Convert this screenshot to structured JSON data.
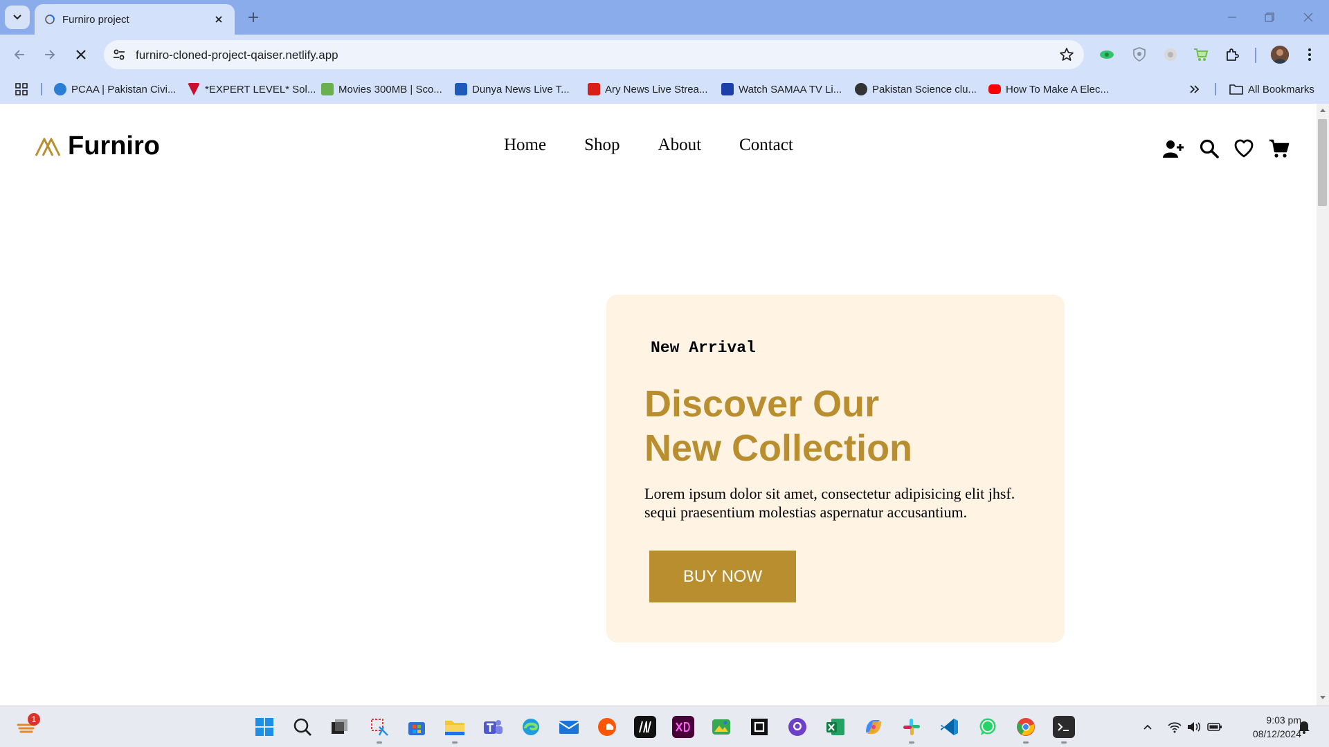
{
  "browser": {
    "tab_title": "Furniro project",
    "url": "furniro-cloned-project-qaiser.netlify.app",
    "bookmarks": [
      {
        "label": "PCAA | Pakistan Civi...",
        "color": "#2a7fd4"
      },
      {
        "label": "*EXPERT LEVEL* Sol...",
        "color": "#c8102e"
      },
      {
        "label": "Movies 300MB | Sco...",
        "color": "#6ab04c"
      },
      {
        "label": "Dunya News Live T...",
        "color": "#1e5bb8"
      },
      {
        "label": "Ary News Live Strea...",
        "color": "#d91e18"
      },
      {
        "label": "Watch SAMAA TV Li...",
        "color": "#1c3faa"
      },
      {
        "label": "Pakistan Science clu...",
        "color": "#333333"
      },
      {
        "label": "How To Make A Elec...",
        "color": "#ff0000"
      }
    ],
    "all_bookmarks": "All Bookmarks"
  },
  "site": {
    "logo": "Furniro",
    "nav": [
      "Home",
      "Shop",
      "About",
      "Contact"
    ],
    "accent_color": "#b88e2f",
    "hero": {
      "eyebrow": "New Arrival",
      "title_line1": "Discover Our",
      "title_line2": "New Collection",
      "desc_line1": "Lorem ipsum dolor sit amet, consectetur adipisicing elit jhsf.",
      "desc_line2": "sequi praesentium molestias aspernatur accusantium.",
      "button": "BUY NOW"
    },
    "header_icons": [
      "add-user-icon",
      "search-icon",
      "heart-icon",
      "cart-icon"
    ]
  },
  "taskbar": {
    "notification_badge": "1",
    "time": "9:03 pm",
    "date": "08/12/2024",
    "apps": [
      "start",
      "search",
      "task-view",
      "snipping-tool",
      "store",
      "file-explorer",
      "teams",
      "edge",
      "mail",
      "soundcloud",
      "notion",
      "adobe-xd",
      "photos",
      "roblox",
      "github",
      "excel",
      "copilot",
      "slack",
      "vscode",
      "whatsapp",
      "chrome",
      "terminal"
    ]
  }
}
